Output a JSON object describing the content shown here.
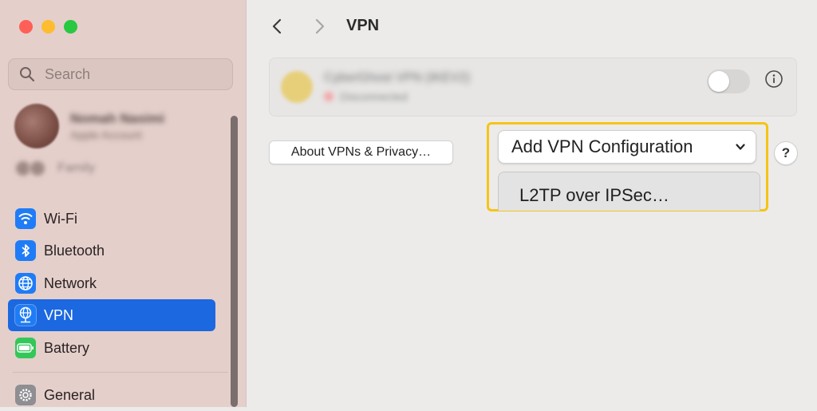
{
  "window": {
    "controls": [
      {
        "name": "close",
        "color": "#fe5f57"
      },
      {
        "name": "minimize",
        "color": "#febc2e"
      },
      {
        "name": "zoom",
        "color": "#28c840"
      }
    ]
  },
  "sidebar": {
    "search_placeholder": "Search",
    "account": {
      "name": "Nomah Nasimi",
      "subtitle": "Apple Account"
    },
    "family_label": "Family",
    "items": [
      {
        "label": "Wi-Fi",
        "icon": "wifi-icon",
        "color": "#1f7cf6",
        "active": false
      },
      {
        "label": "Bluetooth",
        "icon": "bluetooth-icon",
        "color": "#1f7cf6",
        "active": false
      },
      {
        "label": "Network",
        "icon": "globe-icon",
        "color": "#1f7cf6",
        "active": false
      },
      {
        "label": "VPN",
        "icon": "vpn-globe-icon",
        "color": "#1f7cf6",
        "active": true
      },
      {
        "label": "Battery",
        "icon": "battery-icon",
        "color": "#33c759",
        "active": false
      },
      {
        "label": "General",
        "icon": "gear-icon",
        "color": "#8e8e93",
        "active": false
      }
    ]
  },
  "header": {
    "title": "VPN"
  },
  "vpn_entry": {
    "name": "CyberGhost VPN (IKEV2)",
    "status": "Disconnected",
    "toggle_on": false
  },
  "buttons": {
    "about": "About VPNs & Privacy…",
    "add_config": "Add VPN Configuration",
    "help": "?"
  },
  "dropdown_menu": {
    "items": [
      "L2TP over IPSec…"
    ]
  },
  "colors": {
    "accent": "#1b68e0",
    "highlight": "#f5c416"
  }
}
